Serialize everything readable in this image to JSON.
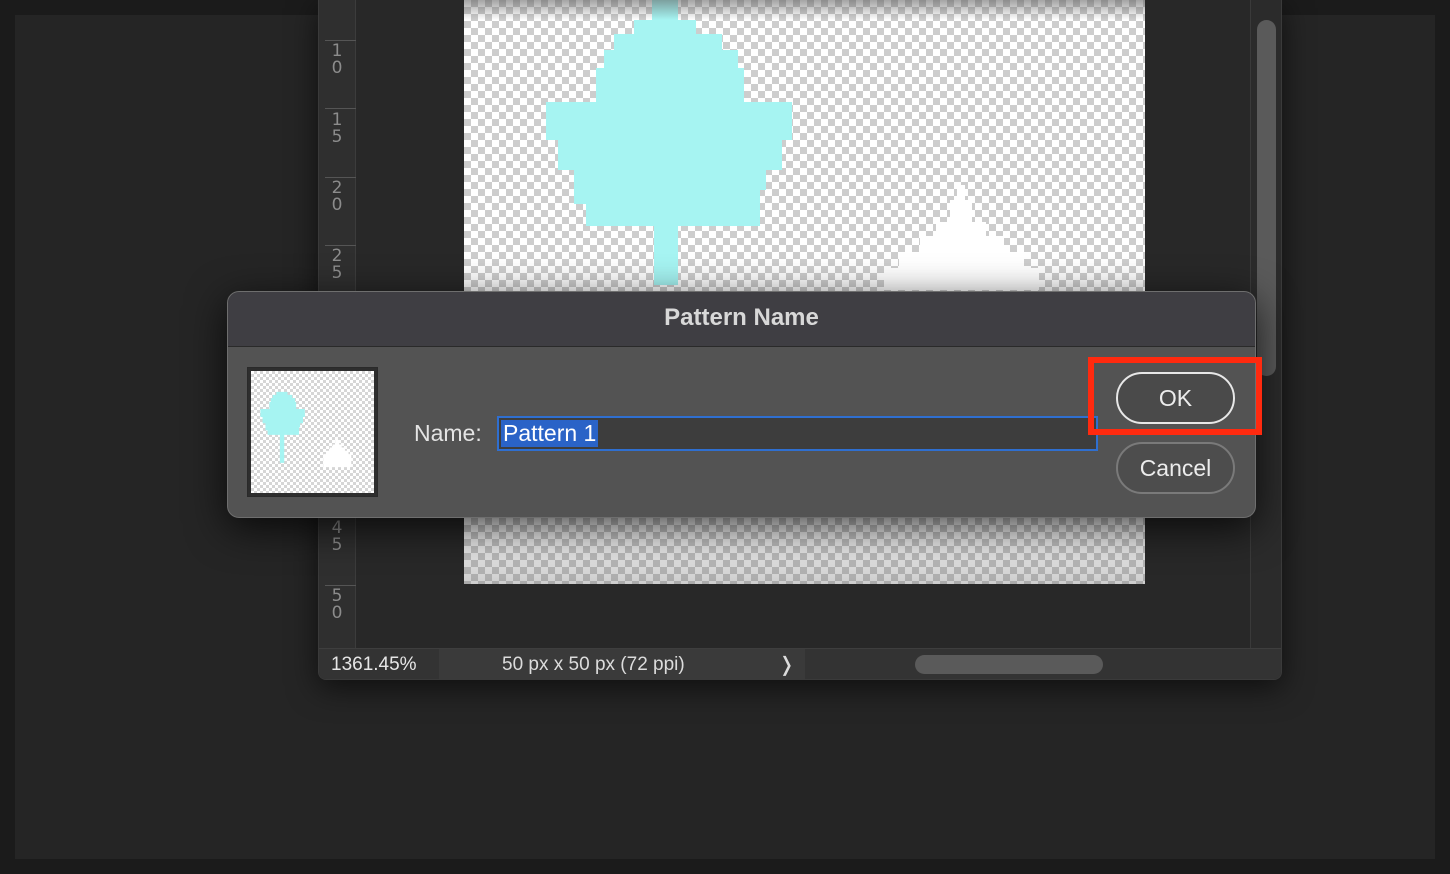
{
  "document": {
    "ruler_labels": [
      [
        "1",
        "0"
      ],
      [
        "1",
        "5"
      ],
      [
        "2",
        "0"
      ],
      [
        "2",
        "5"
      ],
      [
        "4",
        "5"
      ],
      [
        "5",
        "0"
      ]
    ],
    "zoom_level": "1361.45%",
    "doc_info": "50 px x 50 px (72 ppi)",
    "doc_info_arrow": "❭"
  },
  "dialog": {
    "title": "Pattern Name",
    "name_label": "Name:",
    "name_value": "Pattern 1",
    "ok_label": "OK",
    "cancel_label": "Cancel"
  },
  "colors": {
    "leaf": "#a6f4f2",
    "white_leaf": "#ffffff",
    "highlight": "#ff2a0f",
    "selection": "#2a63c7"
  },
  "icons": {
    "pattern_preview": "pattern-preview-icon",
    "doc_info_arrow": "chevron-right-icon"
  }
}
